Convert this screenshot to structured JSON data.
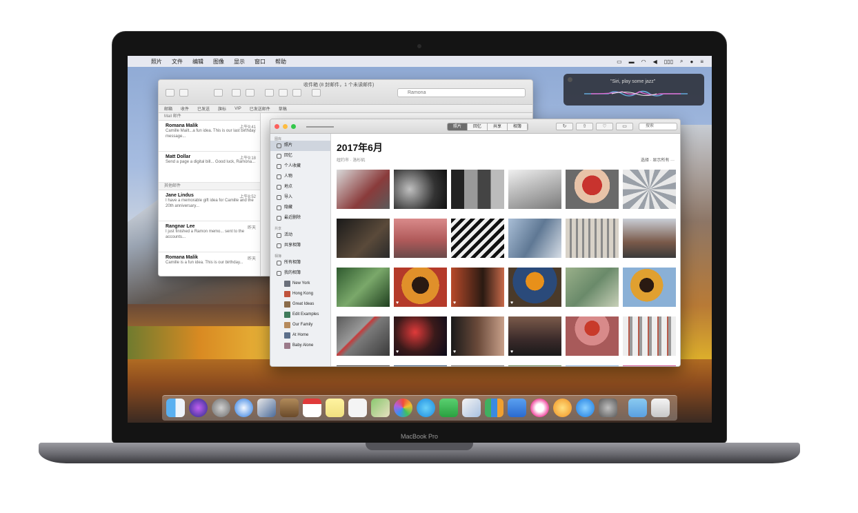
{
  "menubar": {
    "apple_icon": "",
    "items": [
      "照片",
      "文件",
      "编辑",
      "图像",
      "显示",
      "窗口",
      "帮助"
    ],
    "status_icons": [
      "airplay-icon",
      "battery-icon",
      "wifi-icon",
      "volume-icon",
      "clock-icon",
      "search-icon",
      "siri-icon",
      "notification-icon"
    ]
  },
  "siri": {
    "prompt": "\"Siri, play some jazz\""
  },
  "mail": {
    "title": "收件箱 (8 封邮件，1 个未读邮件)",
    "search_value": "Ramona",
    "favorites": [
      "邮箱",
      "收件",
      "已发送",
      "旗标",
      "VIP",
      "已发送邮件",
      "草稿"
    ],
    "group_header_1": "Mail 邮件",
    "group_header_2": "其他邮件",
    "messages": [
      {
        "from": "Romana Malik",
        "date": "上午9:41",
        "body": "Camille Mailt...a fun idea. This is our last birthday message..."
      },
      {
        "from": "Matt Dollar",
        "date": "上午9:18",
        "body": "Send a page a digital bill... Good luck, Ramona..."
      },
      {
        "from": "Jane Lindus",
        "date": "上午8:52",
        "body": "I have a memorable gift idea for Camille and the 20th anniversary..."
      },
      {
        "from": "Rangnar Lee",
        "date": "昨天",
        "body": "I just finished a Ramon memo... sent to the accounts..."
      },
      {
        "from": "Romana Malik",
        "date": "昨天",
        "body": "Camille is a fun idea. This is our birthday..."
      }
    ]
  },
  "photos": {
    "tabs": [
      "照片",
      "回忆",
      "共享",
      "相簿"
    ],
    "active_tab": "照片",
    "search_placeholder": "搜索",
    "month_title": "2017年6月",
    "subtitle": "纽约市 · 洛杉矶",
    "show_all": "选择 · 显示所有 ···",
    "sidebar": {
      "library_header": "图库",
      "library_items": [
        "照片",
        "回忆",
        "个人收藏",
        "人物",
        "地点",
        "导入",
        "隐藏",
        "最近删除"
      ],
      "shared_header": "共享",
      "shared_items": [
        "活动",
        "共享相簿"
      ],
      "albums_header": "相簿",
      "albums_items": [
        "所有相簿",
        "我的相簿"
      ],
      "album_sub": [
        "New York",
        "Hong Kong",
        "Great Ideas",
        "Edit Examples",
        "Our Family",
        "At Home",
        "Baby Alone"
      ]
    }
  },
  "brand": "MacBook Pro"
}
